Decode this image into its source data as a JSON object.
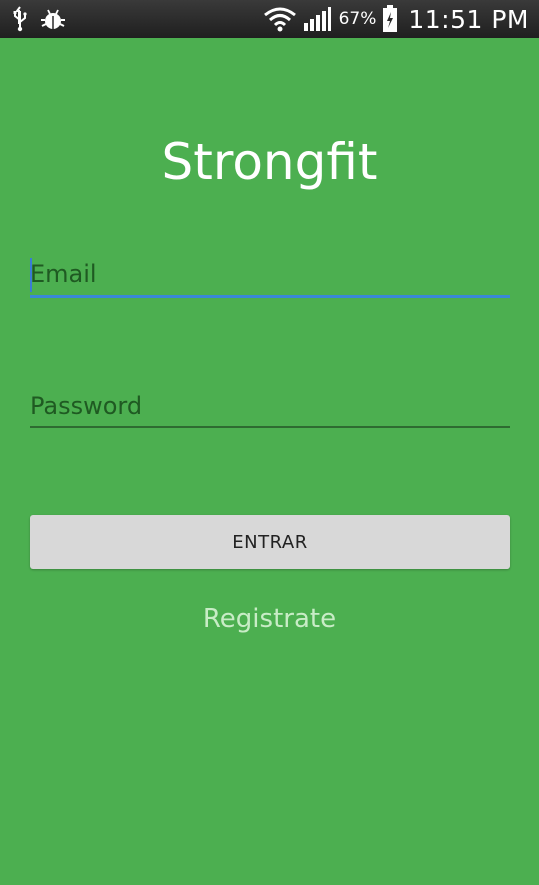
{
  "status_bar": {
    "battery_percent": "67%",
    "time": "11:51 PM",
    "icons": [
      "usb-icon",
      "debug-bug-icon",
      "wifi-icon",
      "signal-icon",
      "battery-charging-icon"
    ]
  },
  "app": {
    "title": "Strongfit",
    "email": {
      "placeholder": "Email",
      "value": ""
    },
    "password": {
      "placeholder": "Password",
      "value": ""
    },
    "login_button_label": "ENTRAR",
    "register_link_label": "Registrate"
  },
  "colors": {
    "background": "#4CAF50",
    "status_bar": "#2a2a2a",
    "focus_underline": "#3a88d8",
    "button": "#d8d8d8",
    "link": "#c8ecc6"
  }
}
